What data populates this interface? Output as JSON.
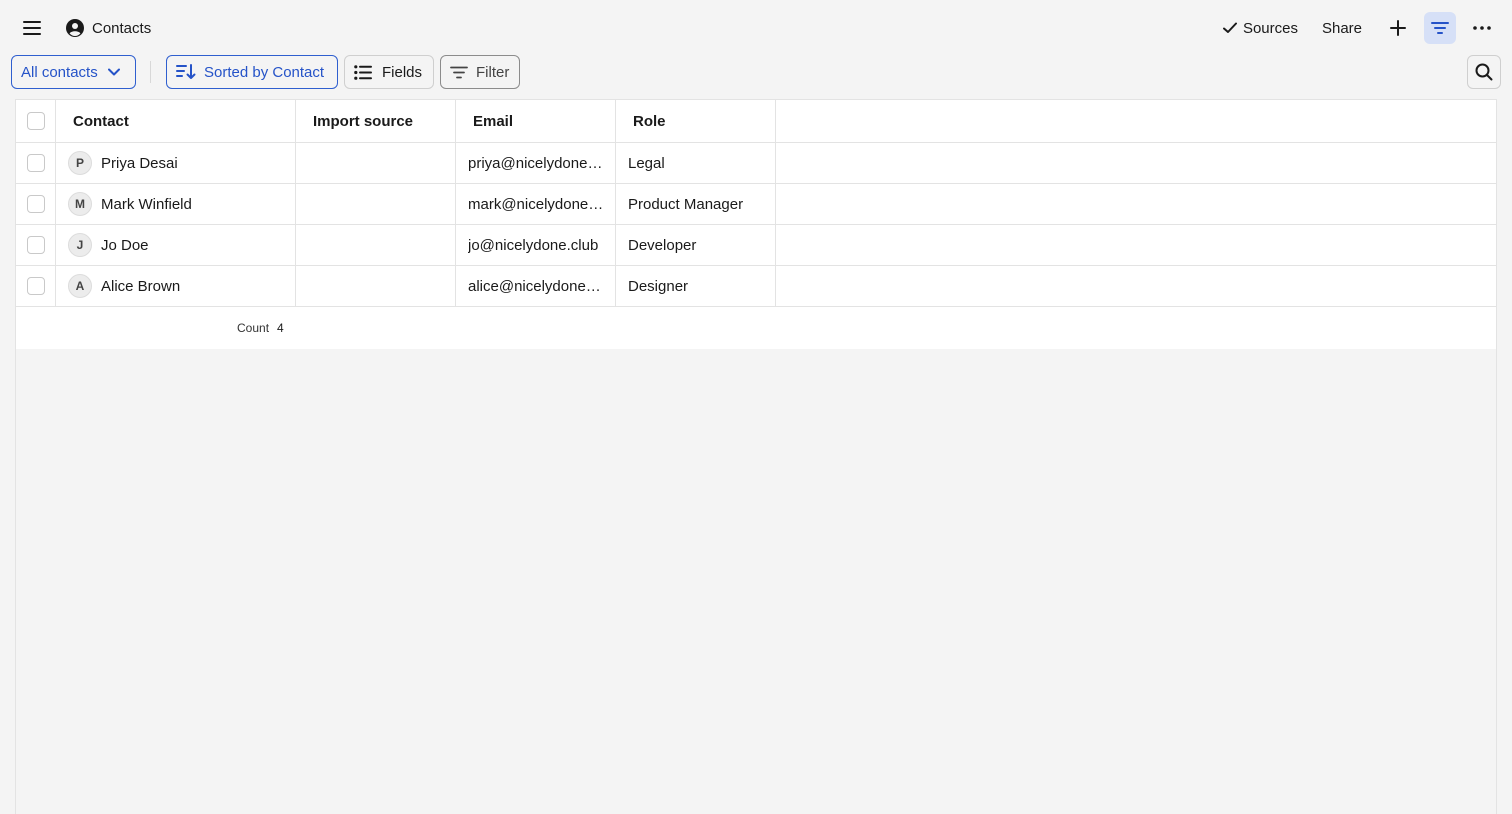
{
  "header": {
    "title": "Contacts",
    "actions": {
      "sources_label": "Sources",
      "share_label": "Share"
    }
  },
  "toolbar": {
    "view_label": "All contacts",
    "sort_label": "Sorted by Contact",
    "fields_label": "Fields",
    "filter_label": "Filter"
  },
  "table": {
    "columns": [
      "Contact",
      "Import source",
      "Email",
      "Role"
    ],
    "rows": [
      {
        "initial": "P",
        "contact": "Priya Desai",
        "import_source": "",
        "email": "priya@nicelydone.club",
        "role": "Legal"
      },
      {
        "initial": "M",
        "contact": "Mark Winfield",
        "import_source": "",
        "email": "mark@nicelydone.club",
        "role": "Product Manager"
      },
      {
        "initial": "J",
        "contact": "Jo Doe",
        "import_source": "",
        "email": "jo@nicelydone.club",
        "role": "Developer"
      },
      {
        "initial": "A",
        "contact": "Alice Brown",
        "import_source": "",
        "email": "alice@nicelydone.club",
        "role": "Designer"
      }
    ],
    "footer": {
      "count_label": "Count",
      "count_value": "4"
    }
  },
  "colors": {
    "accent": "#2553c8",
    "active_bg": "#d6e0f7",
    "background": "#f4f4f4"
  },
  "icons": [
    "menu-icon",
    "user-circle-icon",
    "check-icon",
    "plus-icon",
    "filter-lines-icon",
    "more-icon",
    "chevron-down-icon",
    "sort-icon",
    "list-icon",
    "search-icon"
  ]
}
